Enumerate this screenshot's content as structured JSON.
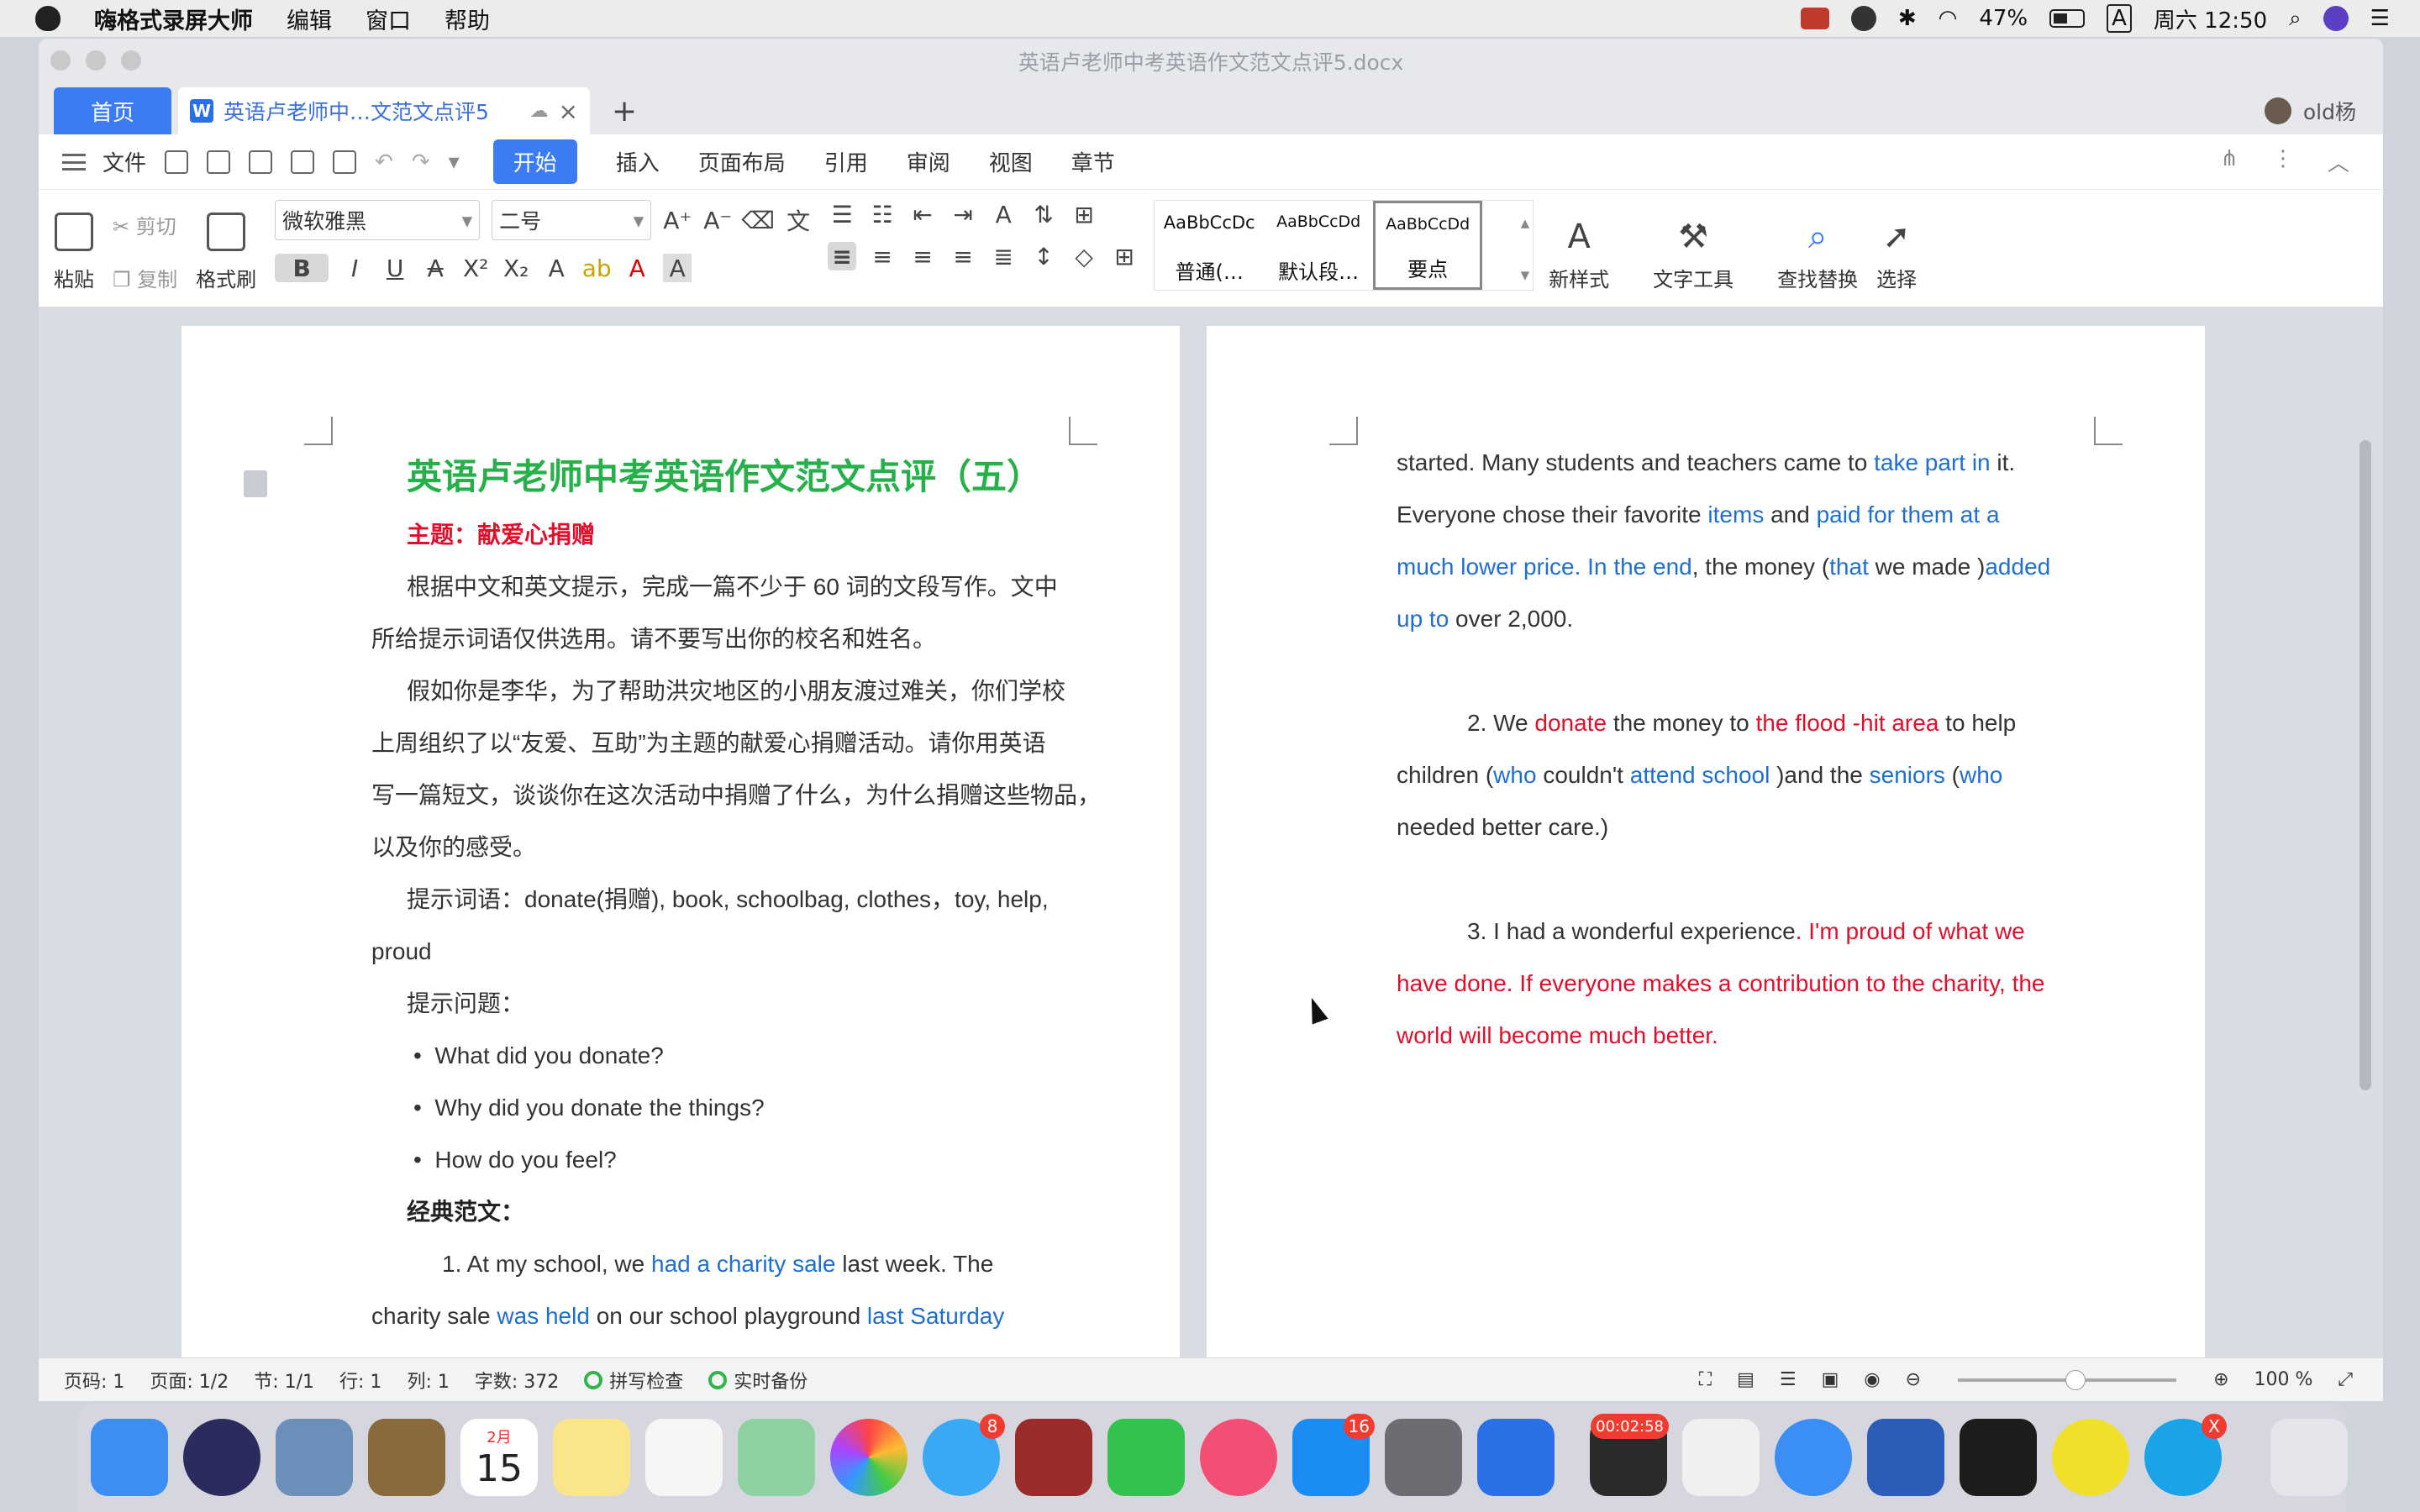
{
  "menubar": {
    "app_name": "嗨格式录屏大师",
    "items": [
      "编辑",
      "窗口",
      "帮助"
    ],
    "battery": "47%",
    "clock": "周六 12:50",
    "input_method": "A"
  },
  "window": {
    "title": "英语卢老师中考英语作文范文点评5.docx",
    "tabs": {
      "home": "首页",
      "doc": "英语卢老师中…文范文点评5",
      "add": "+"
    },
    "user": "old杨"
  },
  "menu": {
    "file": "文件",
    "tabs": [
      "开始",
      "插入",
      "页面布局",
      "引用",
      "审阅",
      "视图",
      "章节"
    ]
  },
  "ribbon": {
    "paste": "粘贴",
    "cut": "剪切",
    "copy": "复制",
    "format_painter": "格式刷",
    "font_name": "微软雅黑",
    "font_size": "二号",
    "styles": [
      {
        "sample": "AaBbCcDc",
        "label": "普通(…"
      },
      {
        "sample": "AaBbCcDd",
        "label": "默认段…"
      },
      {
        "sample": "AaBbCcDd",
        "label": "要点"
      }
    ],
    "new_style": "新样式",
    "text_tools": "文字工具",
    "find_replace": "查找替换",
    "select": "选择"
  },
  "page1": {
    "title": "英语卢老师中考英语作文范文点评（五）",
    "topic_label": "主题：",
    "topic": "献爱心捐赠",
    "para1_l1": "根据中文和英文提示，完成一篇不少于 60 词的文段写作。文中",
    "para1_l2": "所给提示词语仅供选用。请不要写出你的校名和姓名。",
    "para2_l1": "假如你是李华，为了帮助洪灾地区的小朋友渡过难关，你们学校",
    "para2_l2": "上周组织了以“友爱、互助”为主题的献爱心捐赠活动。请你用英语",
    "para2_l3": "写一篇短文，谈谈你在这次活动中捐赠了什么，为什么捐赠这些物品，",
    "para2_l4": "以及你的感受。",
    "hint_words_l1": "提示词语：donate(捐赠), book, schoolbag, clothes，toy, help,",
    "hint_words_l2": "proud",
    "hint_q": "提示问题：",
    "q1": "What did you donate?",
    "q2": "Why did you donate the things?",
    "q3": "How do you feel?",
    "model": "经典范文：",
    "s1_a": "1. At my school, we ",
    "s1_b": "had a charity sale",
    "s1_c": " last week. The",
    "s2_a": "charity sale ",
    "s2_b": "was held",
    "s2_c": " on our school playground ",
    "s2_d": "last Saturday"
  },
  "page2": {
    "l1_a": "started. Many students and teachers came to ",
    "l1_b": "take part in",
    "l1_c": " it.",
    "l2_a": "Everyone chose their favorite ",
    "l2_b": "items",
    "l2_c": " and ",
    "l2_d": "paid for them at a",
    "l3_a": "much lower price. In the end",
    "l3_b": ", the money (",
    "l3_c": "that",
    "l3_d": " we made )",
    "l3_e": "added",
    "l4_a": "up to",
    "l4_b": " over 2,000.",
    "l5_a": "2. We ",
    "l5_b": "donate",
    "l5_c": " the money to ",
    "l5_d": "the flood -hit area",
    "l5_e": " to help",
    "l6_a": "children (",
    "l6_b": "who",
    "l6_c": " couldn't ",
    "l6_d": "attend school",
    "l6_e": " )and the ",
    "l6_f": "seniors",
    "l6_g": " (",
    "l6_h": "who",
    "l7": "needed better care.)",
    "l8_a": "3. I had a wonderful experience",
    "l8_b": ". I'm proud of what we",
    "l9": "have done. If everyone makes a contribution to the charity, the",
    "l10": "world will become much better."
  },
  "status": {
    "page_no": "页码: 1",
    "pages": "页面: 1/2",
    "section": "节: 1/1",
    "row": "行: 1",
    "col": "列: 1",
    "words": "字数: 372",
    "spell": "拼写检查",
    "backup": "实时备份",
    "zoom": "100 %"
  },
  "dock": {
    "calendar_month": "2月",
    "calendar_day": "15",
    "badges": {
      "messages": "8",
      "appstore": "16",
      "recorder": "00:02:58",
      "skype": "X"
    }
  }
}
